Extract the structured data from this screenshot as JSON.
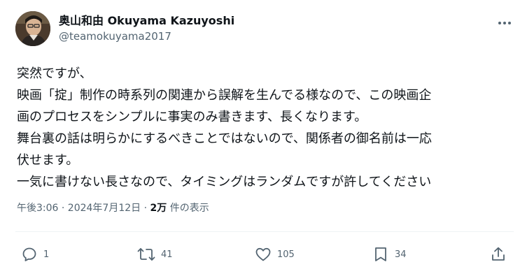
{
  "post": {
    "author": {
      "display_name": "奥山和由 Okuyama Kazuyoshi",
      "handle": "@teamokuyama2017"
    },
    "more_icon": "more-horizontal-icon",
    "text_lines": [
      "突然ですが、",
      "映画「掟」制作の時系列の関連から誤解を生んでる様なので、この映画企",
      "画のプロセスをシンプルに事実のみ書きます、長くなります。",
      "舞台裏の話は明らかにするべきことではないので、関係者の御名前は一応",
      "伏せます。",
      "一気に書けない長さなので、タイミングはランダムですが許してください"
    ],
    "meta": {
      "timestamp": "午後3:06 · 2024年7月12日 · ",
      "views_count": "2万",
      "views_label": " 件の表示"
    },
    "actions": {
      "reply": {
        "icon": "reply-icon",
        "count": "1"
      },
      "repost": {
        "icon": "repost-icon",
        "count": "41"
      },
      "like": {
        "icon": "heart-icon",
        "count": "105"
      },
      "bookmark": {
        "icon": "bookmark-icon",
        "count": "34"
      },
      "share": {
        "icon": "share-icon"
      }
    },
    "colors": {
      "text": "#0f1419",
      "secondary": "#536471",
      "divider": "#eff3f4"
    }
  }
}
